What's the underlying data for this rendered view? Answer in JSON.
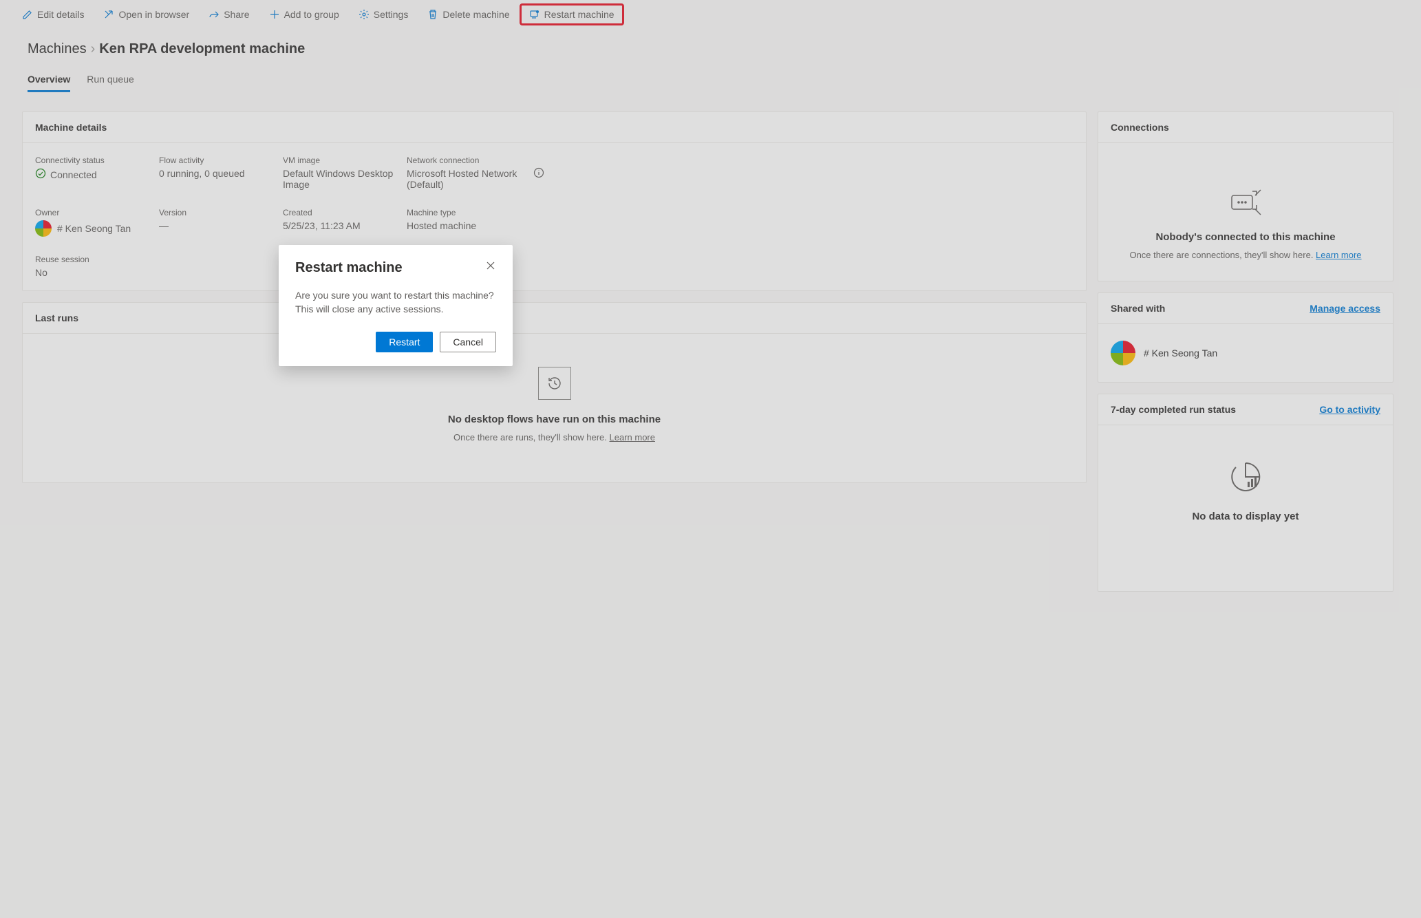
{
  "toolbar": {
    "edit": "Edit details",
    "open": "Open in browser",
    "share": "Share",
    "add": "Add to group",
    "settings": "Settings",
    "delete": "Delete machine",
    "restart": "Restart machine"
  },
  "breadcrumb": {
    "root": "Machines",
    "current": "Ken RPA development machine"
  },
  "tabs": {
    "overview": "Overview",
    "runqueue": "Run queue"
  },
  "details": {
    "card_title": "Machine details",
    "connectivity_label": "Connectivity status",
    "connectivity_value": "Connected",
    "flow_label": "Flow activity",
    "flow_value": "0 running, 0 queued",
    "vm_label": "VM image",
    "vm_value": "Default Windows Desktop Image",
    "net_label": "Network connection",
    "net_value": "Microsoft Hosted Network (Default)",
    "owner_label": "Owner",
    "owner_value": "# Ken Seong Tan",
    "version_label": "Version",
    "version_value": "—",
    "created_label": "Created",
    "created_value": "5/25/23, 11:23 AM",
    "type_label": "Machine type",
    "type_value": "Hosted machine",
    "reuse_label": "Reuse session",
    "reuse_value": "No"
  },
  "last_runs": {
    "title": "Last runs",
    "empty_title": "No desktop flows have run on this machine",
    "empty_sub": "Once there are runs, they'll show here. ",
    "learn_more": "Learn more"
  },
  "connections": {
    "title": "Connections",
    "empty_title": "Nobody's connected to this machine",
    "empty_sub": "Once there are connections, they'll show here. ",
    "learn_more": "Learn more"
  },
  "shared": {
    "title": "Shared with",
    "manage": "Manage access",
    "user": "# Ken Seong Tan"
  },
  "run_status": {
    "title": "7-day completed run status",
    "link": "Go to activity",
    "empty": "No data to display yet"
  },
  "dialog": {
    "title": "Restart machine",
    "body": "Are you sure you want to restart this machine? This will close any active sessions.",
    "primary": "Restart",
    "secondary": "Cancel"
  }
}
